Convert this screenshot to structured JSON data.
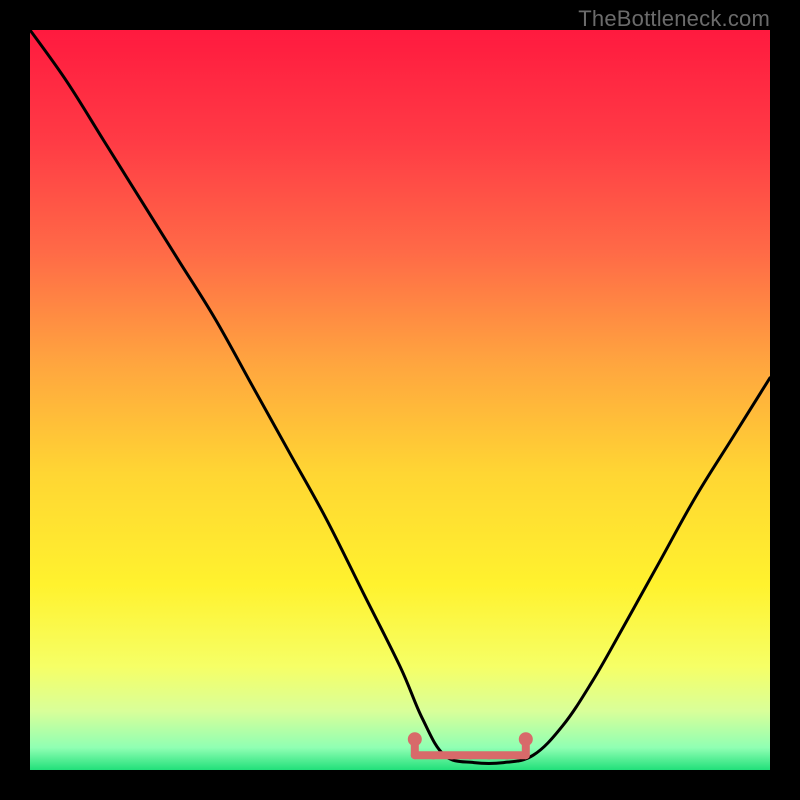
{
  "watermark": "TheBottleneck.com",
  "chart_data": {
    "type": "line",
    "title": "",
    "xlabel": "",
    "ylabel": "",
    "xlim": [
      0,
      100
    ],
    "ylim": [
      0,
      100
    ],
    "grid": false,
    "legend": false,
    "background_gradient": {
      "stops": [
        {
          "offset": 0.0,
          "color": "#ff1a3f"
        },
        {
          "offset": 0.15,
          "color": "#ff3b45"
        },
        {
          "offset": 0.3,
          "color": "#ff6a47"
        },
        {
          "offset": 0.45,
          "color": "#ffa53f"
        },
        {
          "offset": 0.6,
          "color": "#ffd633"
        },
        {
          "offset": 0.75,
          "color": "#fff22e"
        },
        {
          "offset": 0.86,
          "color": "#f6ff66"
        },
        {
          "offset": 0.92,
          "color": "#d9ff99"
        },
        {
          "offset": 0.97,
          "color": "#8fffb3"
        },
        {
          "offset": 1.0,
          "color": "#22e07a"
        }
      ]
    },
    "series": [
      {
        "name": "bottleneck-curve",
        "color": "#000000",
        "x": [
          0,
          5,
          10,
          15,
          20,
          25,
          30,
          35,
          40,
          45,
          50,
          53,
          56,
          60,
          64,
          68,
          72,
          76,
          80,
          85,
          90,
          95,
          100
        ],
        "y": [
          100,
          93,
          85,
          77,
          69,
          61,
          52,
          43,
          34,
          24,
          14,
          7,
          2,
          1,
          1,
          2,
          6,
          12,
          19,
          28,
          37,
          45,
          53
        ]
      }
    ],
    "annotations": [
      {
        "name": "optimal-zone-marker",
        "shape": "bracket",
        "color": "#d86a6a",
        "x_start": 52,
        "x_end": 67,
        "y": 2
      }
    ]
  }
}
